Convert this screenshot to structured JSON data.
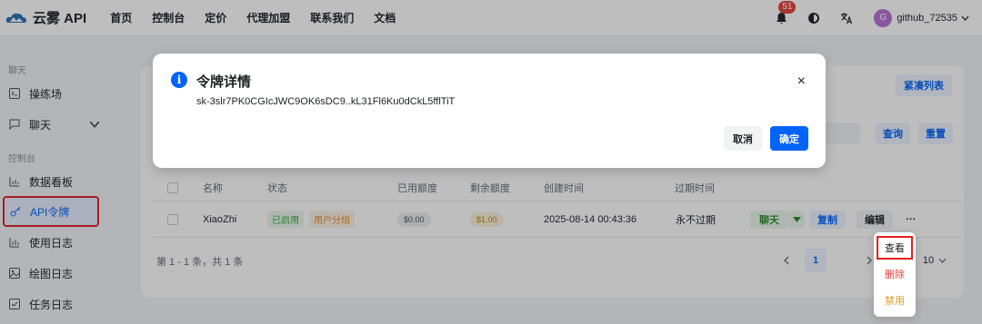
{
  "header": {
    "brand": "云雾 API",
    "nav": [
      "首页",
      "控制台",
      "定价",
      "代理加盟",
      "联系我们",
      "文档"
    ],
    "notification_count": "51",
    "user": {
      "avatar_letter": "G",
      "name": "github_72535"
    }
  },
  "sidebar": {
    "section_chat": "聊天",
    "section_console": "控制台",
    "items": [
      {
        "label": "操练场",
        "icon": "playground-icon"
      },
      {
        "label": "聊天",
        "icon": "chat-icon"
      },
      {
        "label": "数据看板",
        "icon": "dashboard-icon"
      },
      {
        "label": "API令牌",
        "icon": "key-icon"
      },
      {
        "label": "使用日志",
        "icon": "log-icon"
      },
      {
        "label": "绘图日志",
        "icon": "image-icon"
      },
      {
        "label": "任务日志",
        "icon": "task-icon"
      }
    ]
  },
  "toolbar": {
    "compact_list": "紧凑列表",
    "query": "查询",
    "reset": "重置"
  },
  "table": {
    "columns": [
      "名称",
      "状态",
      "已用额度",
      "剩余额度",
      "创建时间",
      "过期时间"
    ],
    "rows": [
      {
        "name": "XiaoZhi",
        "status": "已启用",
        "group": "用户分组",
        "used": "$0.00",
        "remaining": "$1.00",
        "created": "2025-08-14 00:43:36",
        "expires": "永不过期",
        "actions": {
          "chat": "聊天",
          "copy": "复制",
          "edit": "编辑",
          "more": "···"
        }
      }
    ]
  },
  "pagination": {
    "summary": "第 1 - 1 条，共 1 条",
    "current_page": "1",
    "page_size": "10"
  },
  "modal": {
    "title": "令牌详情",
    "key": "sk-3slr7PK0CGIcJWC9OK6sDC9..kL31Fl6Ku0dCkL5fflTiT",
    "cancel": "取消",
    "confirm": "确定",
    "close": "×"
  },
  "dropdown": {
    "view": "查看",
    "delete": "删除",
    "disable": "禁用"
  },
  "colors": {
    "primary": "#0064fa",
    "danger": "#e5413a",
    "warning": "#e8961b",
    "highlight_box": "#e02020"
  }
}
